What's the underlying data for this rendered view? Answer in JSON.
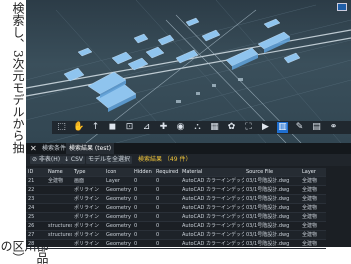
{
  "side_text": {
    "column1": "検索し、3次元モデルから抽",
    "column2": "都品川区）の"
  },
  "toolbar": {
    "icons": [
      {
        "name": "select-icon",
        "glyph": "⬚"
      },
      {
        "name": "hand-icon",
        "glyph": "✋"
      },
      {
        "name": "move-up-icon",
        "glyph": "↑"
      },
      {
        "name": "camera-icon",
        "glyph": "◼"
      },
      {
        "name": "measure-icon",
        "glyph": "⊡"
      },
      {
        "name": "section-icon",
        "glyph": "⊿"
      },
      {
        "name": "add-icon",
        "glyph": "✚"
      },
      {
        "name": "visibility-icon",
        "glyph": "◉"
      },
      {
        "name": "tree-icon",
        "glyph": "⛬"
      },
      {
        "name": "grid-icon",
        "glyph": "▦"
      },
      {
        "name": "settings-icon",
        "glyph": "✿"
      },
      {
        "name": "fullscreen-icon",
        "glyph": "⛶"
      },
      {
        "name": "video-icon",
        "glyph": "▶"
      },
      {
        "name": "layers-icon",
        "glyph": "▥"
      },
      {
        "name": "pen-icon",
        "glyph": "✎"
      },
      {
        "name": "document-icon",
        "glyph": "▤"
      },
      {
        "name": "link-icon",
        "glyph": "⚭"
      }
    ]
  },
  "tabs": {
    "close": "✕",
    "items": [
      {
        "label": "検索条件"
      },
      {
        "label": "検索結果 (test)",
        "active": true
      }
    ]
  },
  "filterbar": {
    "filter_btn": "⊘ 非表(H)",
    "csv_btn": "↓ CSV",
    "model_btn": "モデルを全選択",
    "result_count": "検索結果 （49 件）"
  },
  "table": {
    "headers": [
      "ID",
      "Name",
      "Type",
      "Icon",
      "Hidden",
      "Required",
      "Material",
      "Source File",
      "Layer"
    ],
    "rows": [
      [
        "21",
        "全建物",
        "画面",
        "Layer",
        "0",
        "0",
        "AutoCAD カラーインデックス7",
        "03/1号階設計.dwg",
        "全建物"
      ],
      [
        "22",
        "",
        "ポリライン",
        "Geometry",
        "0",
        "0",
        "AutoCAD カラーインデックス7",
        "03/1号階設計.dwg",
        "全建物"
      ],
      [
        "23",
        "",
        "ポリライン",
        "Geometry",
        "0",
        "0",
        "AutoCAD カラーインデックス7",
        "03/1号階設計.dwg",
        "全建物"
      ],
      [
        "24",
        "",
        "ポリライン",
        "Geometry",
        "0",
        "0",
        "AutoCAD カラーインデックス7",
        "03/1号階設計.dwg",
        "全建物"
      ],
      [
        "25",
        "",
        "ポリライン",
        "Geometry",
        "0",
        "0",
        "AutoCAD カラーインデックス7",
        "03/1号階設計.dwg",
        "全建物"
      ],
      [
        "26",
        "structures",
        "ポリライン",
        "Geometry",
        "0",
        "0",
        "AutoCAD カラーインデックス7",
        "03/1号階設計.dwg",
        "全建物"
      ],
      [
        "27",
        "structures",
        "ポリライン",
        "Geometry",
        "0",
        "0",
        "AutoCAD カラーインデックス7",
        "03/1号階設計.dwg",
        "全建物"
      ],
      [
        "28",
        "",
        "ポリライン",
        "Geometry",
        "0",
        "0",
        "AutoCAD カラーインデックス7",
        "03/1号階設計.dwg",
        "全建物"
      ]
    ]
  }
}
